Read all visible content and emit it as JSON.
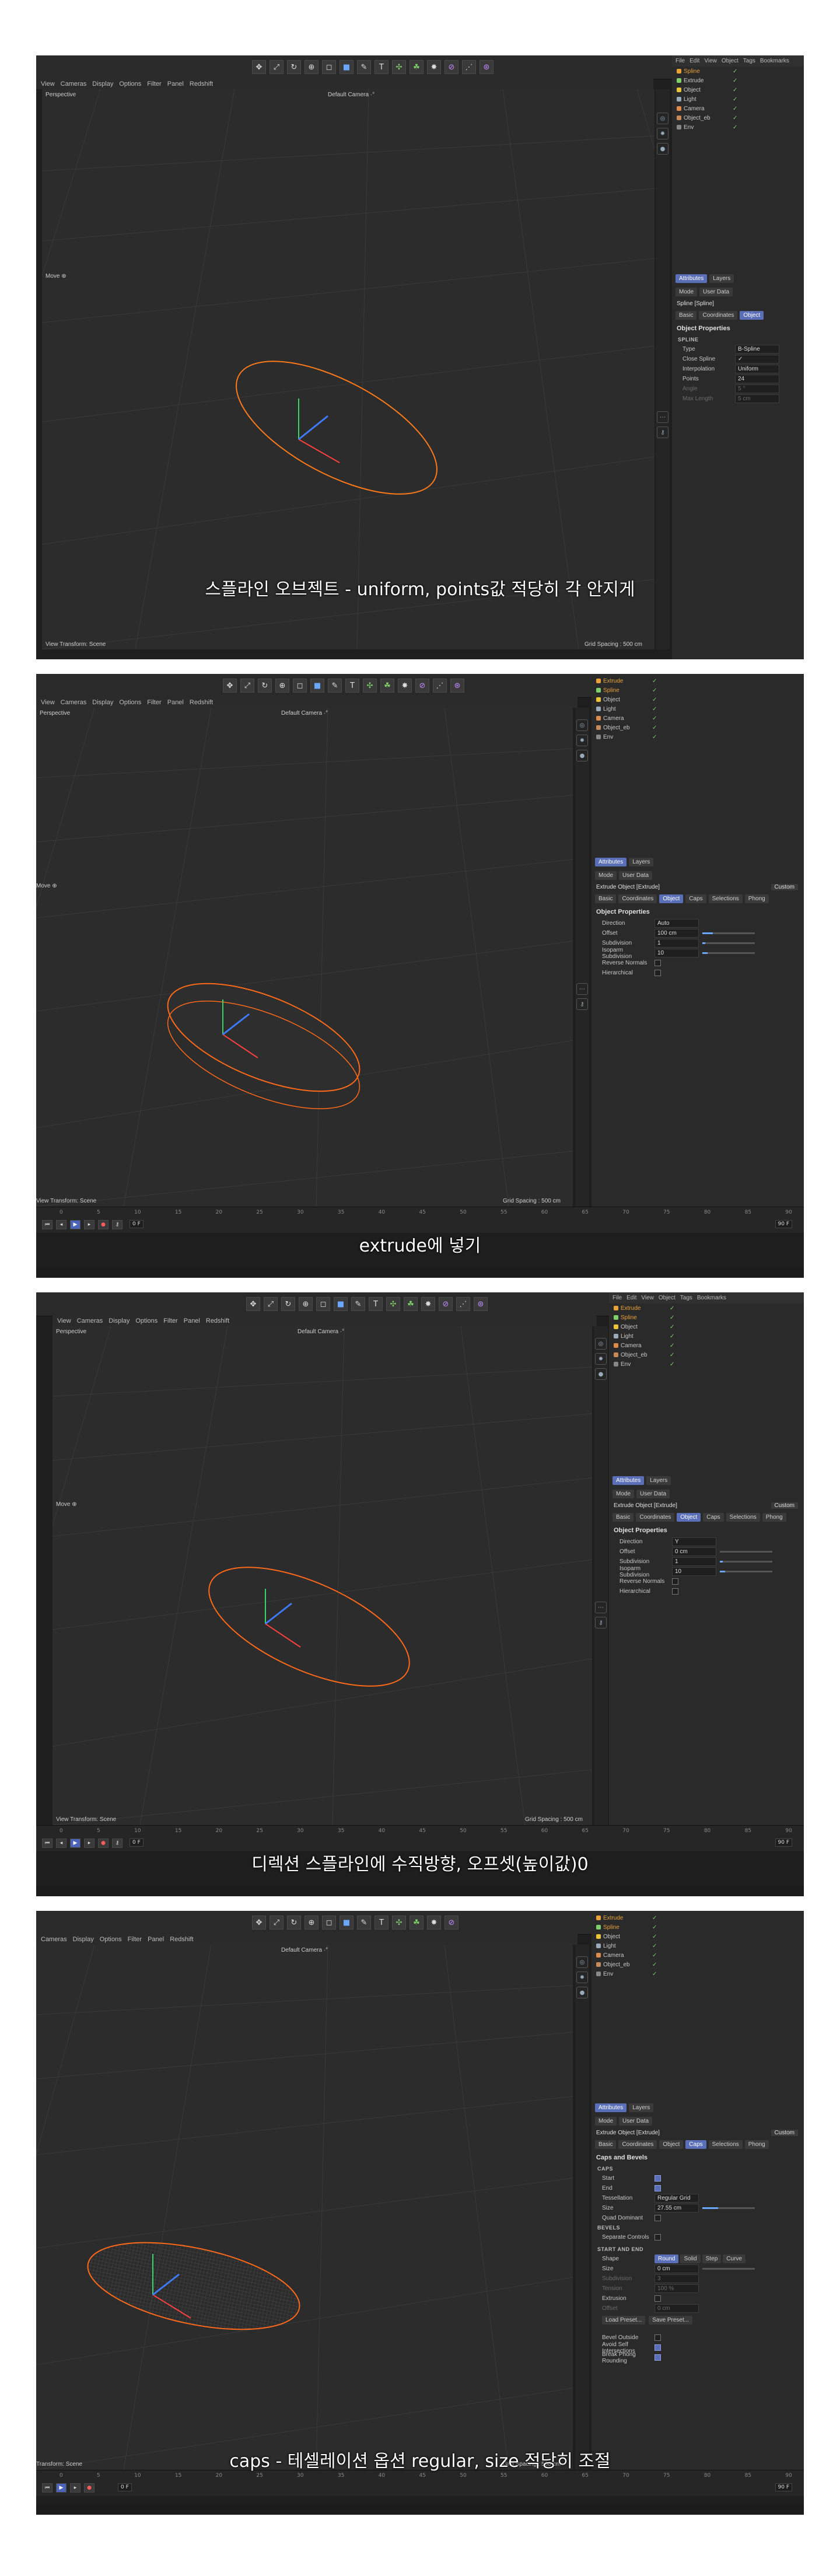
{
  "app": {
    "main_menu": [
      "File",
      "Edit",
      "View",
      "Object",
      "Tags",
      "Bookmarks"
    ],
    "vp_menu": [
      "View",
      "Cameras",
      "Display",
      "Options",
      "Filter",
      "Panel",
      "Redshift"
    ],
    "vp_menu_frame4": [
      "Cameras",
      "Display",
      "Options",
      "Filter",
      "Panel",
      "Redshift"
    ],
    "viewport_label": "Perspective",
    "camera_label": "Default Camera ·°",
    "move_label": "Move ⊕",
    "transform_label": "View Transform: Scene",
    "transform_label_short": "Transform: Scene",
    "grid_label": "Grid Spacing : 500 cm",
    "attr_tabs": [
      "Attributes",
      "Layers"
    ],
    "attr_mode": [
      "Mode",
      "User Data"
    ],
    "colors": {
      "accent": "#5a6fb7",
      "spline": "#ff7a1a",
      "bg": "#1e1e1e"
    },
    "icons": [
      "move-icon",
      "scale-icon",
      "rotate-icon",
      "cube-icon",
      "pen-icon",
      "text-icon",
      "light-icon",
      "camera-icon",
      "gear-icon"
    ]
  },
  "timeline": {
    "ticks": [
      "0",
      "5",
      "10",
      "15",
      "20",
      "25",
      "30",
      "35",
      "40",
      "45",
      "50",
      "55",
      "60",
      "65",
      "70",
      "75",
      "80",
      "85",
      "90"
    ],
    "frame_field": "0 F",
    "end_field": "90 F"
  },
  "frames": [
    {
      "caption": "스플라인 오브젝트 - uniform, points값 적당히 각 안지게",
      "objects": [
        {
          "name": "Spline",
          "active": true
        },
        {
          "name": "Extrude",
          "active": false
        },
        {
          "name": "Object",
          "active": false
        },
        {
          "name": "Light",
          "active": false
        },
        {
          "name": "Camera",
          "active": false
        },
        {
          "name": "Object_eb",
          "active": false
        },
        {
          "name": "Env",
          "active": false
        }
      ],
      "object_title": "Spline [Spline]",
      "tabs": [
        "Basic",
        "Coordinates",
        "Object"
      ],
      "active_tab": "Object",
      "section": "Object Properties",
      "subsection": "SPLINE",
      "props": [
        {
          "label": "Type",
          "value": "B-Spline"
        },
        {
          "label": "Close Spline",
          "value": "✓"
        },
        {
          "label": "Interpolation",
          "value": "Uniform"
        },
        {
          "label": "Points",
          "value": "24"
        },
        {
          "label": "Angle",
          "value": "5 °",
          "dim": true
        },
        {
          "label": "Max Length",
          "value": "5 cm",
          "dim": true
        }
      ]
    },
    {
      "caption": "extrude에 넣기",
      "objects": [
        {
          "name": "Extrude",
          "active": true
        },
        {
          "name": "Spline",
          "active": true
        },
        {
          "name": "Object",
          "active": false
        },
        {
          "name": "Light",
          "active": false
        },
        {
          "name": "Camera",
          "active": false
        },
        {
          "name": "Object_eb",
          "active": false
        },
        {
          "name": "Env",
          "active": false
        }
      ],
      "object_title": "Extrude Object [Extrude]",
      "preset": "Custom",
      "tabs": [
        "Basic",
        "Coordinates",
        "Object",
        "Caps",
        "Selections",
        "Phong"
      ],
      "active_tab": "Object",
      "section": "Object Properties",
      "props": [
        {
          "label": "Direction",
          "value": "Auto"
        },
        {
          "label": "Offset",
          "value": "100 cm",
          "slider": 0.2
        },
        {
          "label": "Subdivision",
          "value": "1",
          "slider": 0.05
        },
        {
          "label": "Isoparm Subdivision",
          "value": "10",
          "slider": 0.1
        },
        {
          "label": "Reverse Normals",
          "value": "",
          "check": false
        },
        {
          "label": "Hierarchical",
          "value": "",
          "check": false
        }
      ]
    },
    {
      "caption": "디렉션 스플라인에 수직방향, 오프셋(높이값)0",
      "objects": [
        {
          "name": "Extrude",
          "active": true
        },
        {
          "name": "Spline",
          "active": true
        },
        {
          "name": "Object",
          "active": false
        },
        {
          "name": "Light",
          "active": false
        },
        {
          "name": "Camera",
          "active": false
        },
        {
          "name": "Object_eb",
          "active": false
        },
        {
          "name": "Env",
          "active": false
        }
      ],
      "object_title": "Extrude Object [Extrude]",
      "preset": "Custom",
      "tabs": [
        "Basic",
        "Coordinates",
        "Object",
        "Caps",
        "Selections",
        "Phong"
      ],
      "active_tab": "Object",
      "section": "Object Properties",
      "props": [
        {
          "label": "Direction",
          "value": "Y"
        },
        {
          "label": "Offset",
          "value": "0 cm",
          "slider": 0.0
        },
        {
          "label": "Subdivision",
          "value": "1",
          "slider": 0.05
        },
        {
          "label": "Isoparm Subdivision",
          "value": "10",
          "slider": 0.1
        },
        {
          "label": "Reverse Normals",
          "value": "",
          "check": false
        },
        {
          "label": "Hierarchical",
          "value": "",
          "check": false
        }
      ]
    },
    {
      "caption": "caps - 테셀레이션 옵션 regular, size 적당히 조절",
      "objects": [
        {
          "name": "Extrude",
          "active": true
        },
        {
          "name": "Spline",
          "active": true
        },
        {
          "name": "Object",
          "active": false
        },
        {
          "name": "Light",
          "active": false
        },
        {
          "name": "Camera",
          "active": false
        },
        {
          "name": "Object_eb",
          "active": false
        },
        {
          "name": "Env",
          "active": false
        }
      ],
      "object_title": "Extrude Object [Extrude]",
      "preset": "Custom",
      "tabs": [
        "Basic",
        "Coordinates",
        "Object",
        "Caps",
        "Selections",
        "Phong"
      ],
      "active_tab": "Caps",
      "section": "Caps and Bevels",
      "subsection": "CAPS",
      "props": [
        {
          "label": "Start",
          "value": "",
          "check": true
        },
        {
          "label": "End",
          "value": "",
          "check": true
        },
        {
          "label": "Tessellation",
          "value": "Regular Grid"
        },
        {
          "label": "Size",
          "value": "27.55 cm",
          "slider": 0.3
        },
        {
          "label": "Quad Dominant",
          "value": "",
          "check": false
        }
      ],
      "bevels_head": "BEVELS",
      "bevels": [
        {
          "label": "Separate Controls",
          "value": "",
          "check": false
        }
      ],
      "startend_head": "START AND END",
      "shape_label": "Shape",
      "shapes": [
        "Round",
        "Solid",
        "Step",
        "Curve"
      ],
      "startend": [
        {
          "label": "Size",
          "value": "0 cm",
          "slider": 0.0
        },
        {
          "label": "Subdivision",
          "value": "3",
          "dim": true
        },
        {
          "label": "Tension",
          "value": "100 %",
          "dim": true
        },
        {
          "label": "Extrusion",
          "value": "",
          "check": false
        },
        {
          "label": "Offset",
          "value": "0 cm",
          "dim": true
        }
      ],
      "buttons": [
        "Load Preset...",
        "Save Preset..."
      ],
      "extra": [
        {
          "label": "Bevel Outside",
          "value": "",
          "check": false
        },
        {
          "label": "Avoid Self Intersections",
          "value": "",
          "check": true
        },
        {
          "label": "Break Phong Rounding",
          "value": "",
          "check": true
        }
      ]
    }
  ]
}
